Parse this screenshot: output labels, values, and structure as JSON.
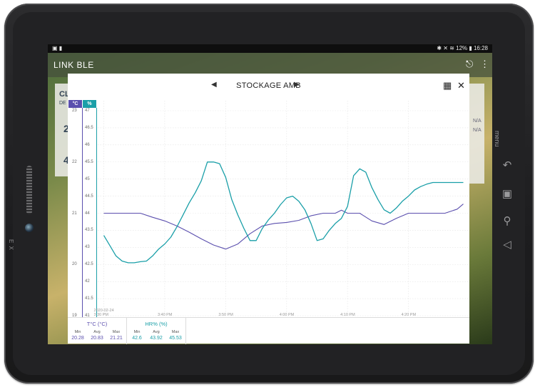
{
  "status_bar": {
    "left_icons": "▣ ▮",
    "right_text": "✱ ✕ ≋ 12% ▮ 16:28"
  },
  "app": {
    "title": "LINK BLE"
  },
  "background_cards": {
    "left_labels": [
      "CL",
      "DE",
      "2",
      "4"
    ],
    "right_labels": [
      "N/A",
      "N/A"
    ]
  },
  "dialog": {
    "title": "STOCKAGE AMB"
  },
  "axes": {
    "temp_header": "°C",
    "hum_header": "%",
    "temp_ticks": [
      "23",
      "22",
      "21",
      "20",
      "19"
    ],
    "hum_ticks": [
      "47",
      "46.5",
      "46",
      "45.5",
      "45",
      "44.5",
      "44",
      "43.5",
      "43",
      "42.5",
      "42",
      "41.5",
      "41"
    ]
  },
  "chart_data": {
    "type": "line",
    "title": "STOCKAGE AMB",
    "x_tick_labels": [
      "2020-02-24\n3:30 PM",
      "3:40 PM",
      "3:50 PM",
      "4:00 PM",
      "4:10 PM",
      "4:20 PM"
    ],
    "x_minutes": [
      0,
      10,
      20,
      30,
      40,
      50
    ],
    "y_left": {
      "label": "°C",
      "range": [
        19,
        23
      ]
    },
    "y_right": {
      "label": "%",
      "range": [
        41,
        47
      ]
    },
    "grid": true,
    "series": [
      {
        "name": "T°C (°C)",
        "axis": "left",
        "color": "#5b4fae",
        "x": [
          0,
          2,
          4,
          6,
          8,
          10,
          12,
          14,
          16,
          18,
          20,
          22,
          24,
          26,
          28,
          30,
          32,
          34,
          36,
          38,
          39,
          40,
          42,
          44,
          46,
          48,
          50,
          52,
          54,
          56,
          58,
          59
        ],
        "y": [
          21.0,
          21.0,
          21.0,
          21.0,
          20.92,
          20.85,
          20.75,
          20.63,
          20.5,
          20.38,
          20.3,
          20.4,
          20.6,
          20.75,
          20.8,
          20.82,
          20.86,
          20.95,
          21.0,
          21.0,
          21.06,
          21.0,
          21.0,
          20.85,
          20.78,
          20.9,
          21.0,
          21.0,
          21.0,
          21.0,
          21.08,
          21.18
        ]
      },
      {
        "name": "HR% (%)",
        "axis": "right",
        "color": "#1a9fa8",
        "x": [
          0,
          1,
          2,
          3,
          4,
          5,
          6,
          7,
          8,
          9,
          10,
          11,
          12,
          13,
          14,
          15,
          16,
          17,
          18,
          19,
          20,
          21,
          22,
          23,
          24,
          25,
          26,
          27,
          28,
          29,
          30,
          31,
          32,
          33,
          34,
          35,
          36,
          37,
          38,
          39,
          40,
          41,
          42,
          43,
          44,
          45,
          46,
          47,
          48,
          49,
          50,
          51,
          52,
          53,
          54,
          55,
          56,
          57,
          58,
          59
        ],
        "y": [
          43.35,
          43.05,
          42.75,
          42.6,
          42.55,
          42.55,
          42.58,
          42.6,
          42.75,
          42.95,
          43.1,
          43.3,
          43.6,
          43.95,
          44.3,
          44.6,
          44.95,
          45.5,
          45.5,
          45.45,
          45.05,
          44.4,
          43.95,
          43.55,
          43.2,
          43.2,
          43.55,
          43.8,
          44.0,
          44.25,
          44.45,
          44.5,
          44.35,
          44.1,
          43.7,
          43.2,
          43.25,
          43.5,
          43.7,
          43.85,
          44.2,
          45.1,
          45.3,
          45.2,
          44.75,
          44.4,
          44.1,
          44.0,
          44.15,
          44.35,
          44.5,
          44.68,
          44.78,
          44.85,
          44.9,
          44.9,
          44.9,
          44.9,
          44.9,
          44.9
        ]
      }
    ]
  },
  "stats": [
    {
      "name": "T°C (°C)",
      "color": "#5b4fae",
      "min_label": "Min",
      "avg_label": "Avg",
      "max_label": "Max",
      "min": "20.28",
      "avg": "20.83",
      "max": "21.21"
    },
    {
      "name": "HR% (%)",
      "color": "#1a9fa8",
      "min_label": "Min",
      "avg_label": "Avg",
      "max_label": "Max",
      "min": "42.6",
      "avg": "43.92",
      "max": "45.53"
    }
  ]
}
